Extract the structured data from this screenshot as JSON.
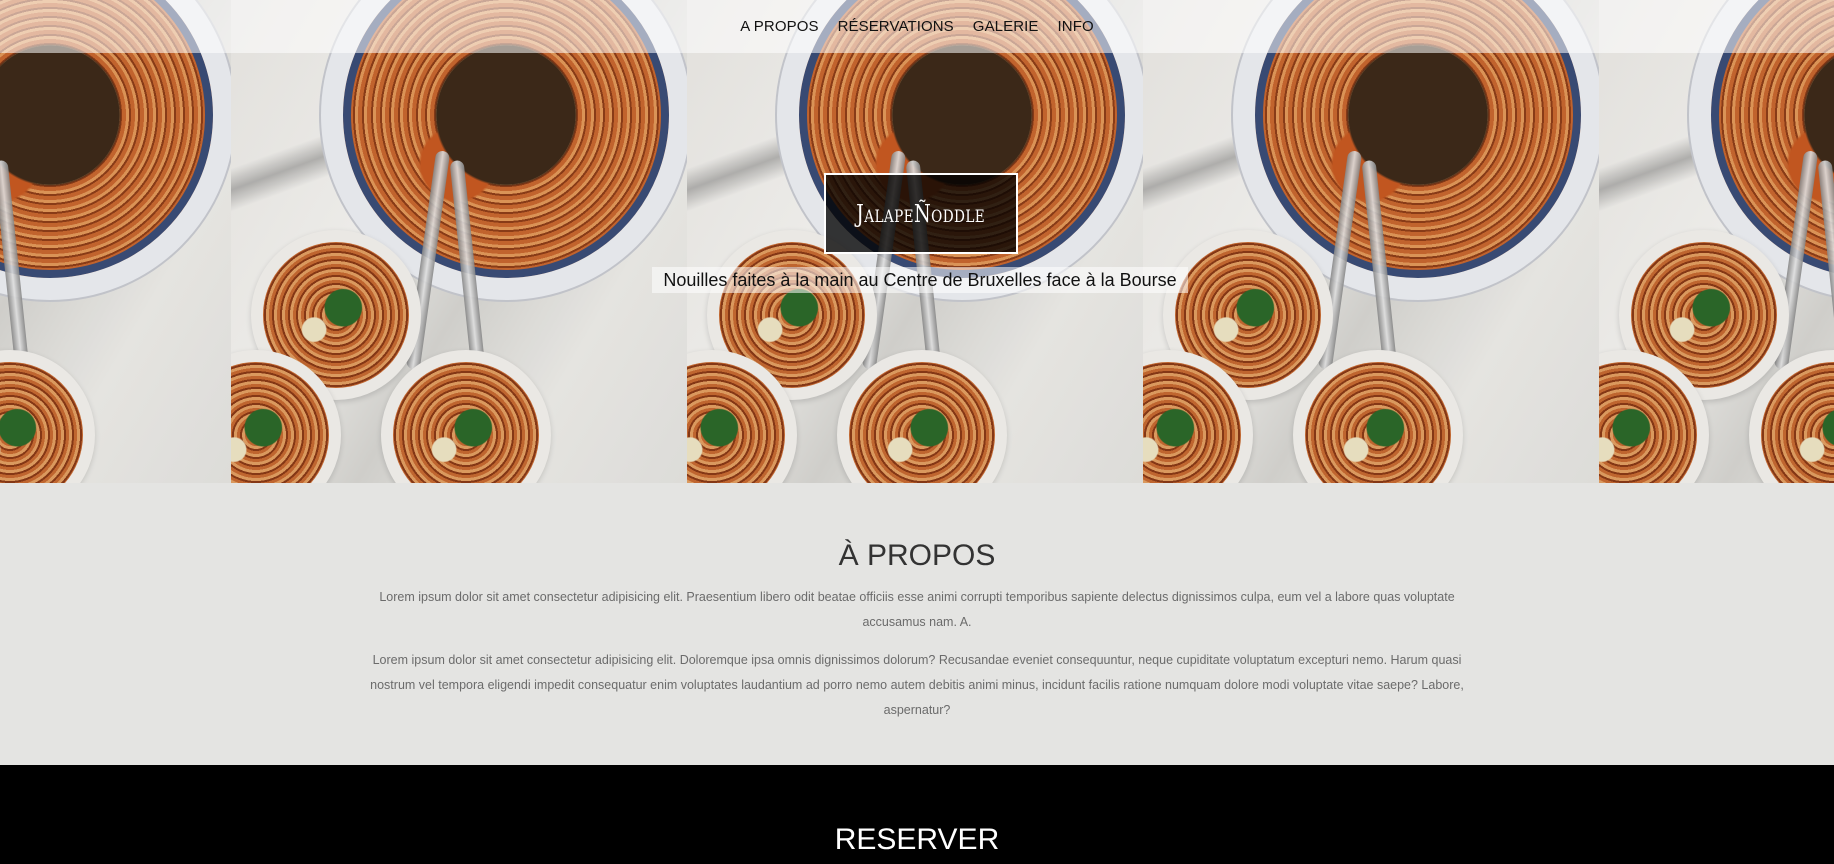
{
  "nav": {
    "items": [
      {
        "label": "A PROPOS"
      },
      {
        "label": "RÉSERVATIONS"
      },
      {
        "label": "GALERIE"
      },
      {
        "label": "INFO"
      }
    ]
  },
  "hero": {
    "brand": "JalapeÑoddle",
    "tagline": "Nouilles faites à la main au Centre de Bruxelles face à la Bourse",
    "image_alt": "noodle-bowls-photo"
  },
  "about": {
    "title": "À PROPOS",
    "paragraph1": "Lorem ipsum dolor sit amet consectetur adipisicing elit. Praesentium libero odit beatae officiis esse animi corrupti temporibus sapiente delectus dignissimos culpa, eum vel a labore quas voluptate accusamus nam. A.",
    "paragraph2": "Lorem ipsum dolor sit amet consectetur adipisicing elit. Doloremque ipsa omnis dignissimos dolorum? Recusandae eveniet consequuntur, neque cupiditate voluptatum excepturi nemo. Harum quasi nostrum vel tempora eligendi impedit consequatur enim voluptates laudantium ad porro nemo autem debitis animi minus, incidunt facilis ratione numquam dolore modi voluptate vitae saepe? Labore, aspernatur?"
  },
  "reserve": {
    "title": "RESERVER"
  },
  "colors": {
    "about_bg": "#e4e4e2",
    "reserve_bg": "#000000",
    "brand_box_bg": "#000000",
    "text_dark": "#333333"
  }
}
